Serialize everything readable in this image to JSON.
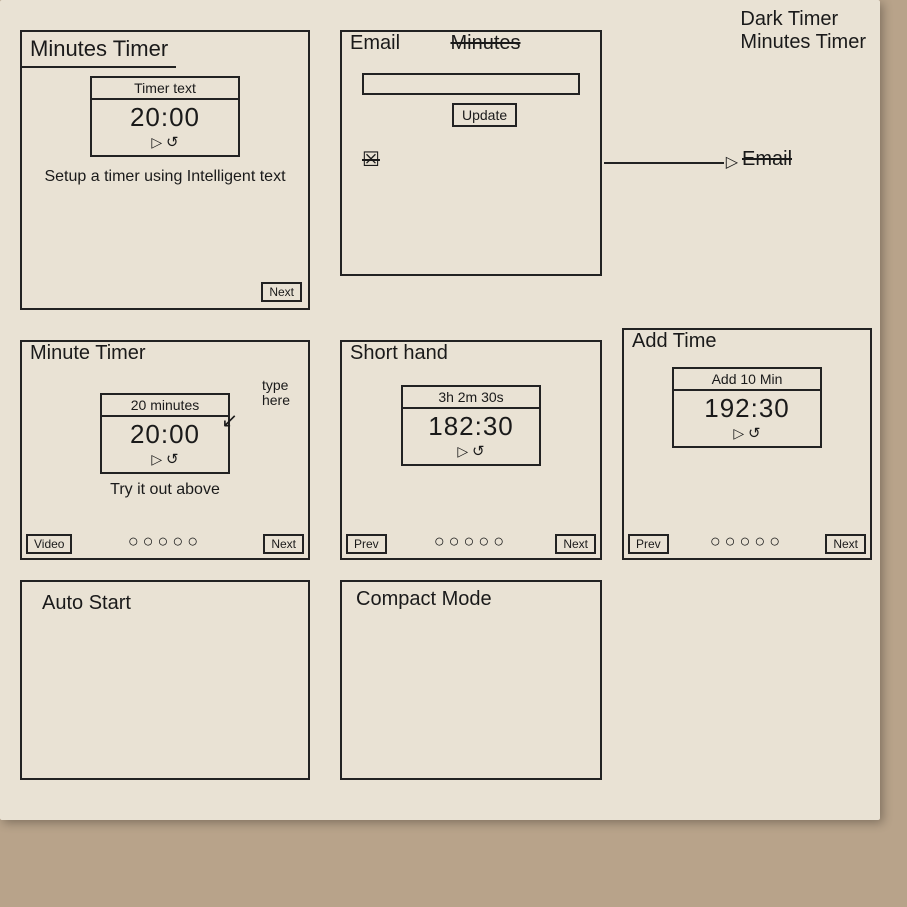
{
  "corner_notes": {
    "line1": "Dark Timer",
    "line2": "Minutes Timer"
  },
  "email_arrow_label": "Email",
  "panels": {
    "p1": {
      "title": "Minutes Timer",
      "timer_label": "Timer text",
      "time": "20:00",
      "caption": "Setup a timer using Intelligent text",
      "next": "Next"
    },
    "p2": {
      "title": "Email",
      "struck_title": "Minutes",
      "button": "Update",
      "scribble": "☒"
    },
    "p3": {
      "title": "Minute Timer",
      "type_hint": "type\nhere",
      "timer_label": "20 minutes",
      "time": "20:00",
      "caption": "Try it out above",
      "left_btn": "Video",
      "next": "Next",
      "pager": "○○○○○"
    },
    "p4": {
      "title": "Short hand",
      "timer_label": "3h 2m 30s",
      "time": "182:30",
      "prev": "Prev",
      "next": "Next",
      "pager": "○○○○○"
    },
    "p5": {
      "title": "Add Time",
      "timer_label": "Add 10 Min",
      "time": "192:30",
      "prev": "Prev",
      "next": "Next",
      "pager": "○○○○○"
    },
    "p6": {
      "title": "Auto Start"
    },
    "p7": {
      "title": "Compact Mode"
    }
  }
}
